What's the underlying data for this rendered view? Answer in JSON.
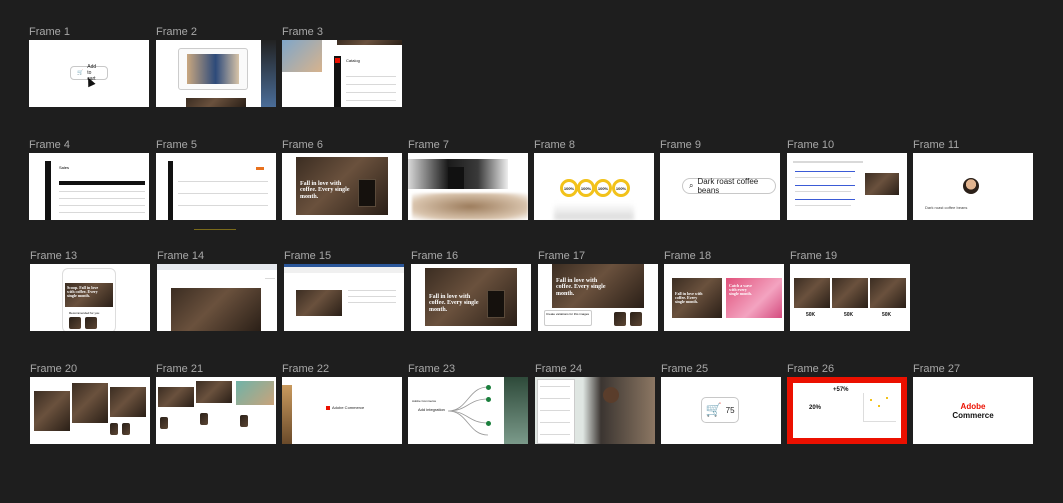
{
  "frames": {
    "f1": {
      "label": "Frame 1",
      "button": "Add to cart"
    },
    "f2": {
      "label": "Frame 2"
    },
    "f3": {
      "label": "Frame 3",
      "heading": "Catalog"
    },
    "f4": {
      "label": "Frame 4",
      "heading": "Sales"
    },
    "f5": {
      "label": "Frame 5"
    },
    "f6": {
      "label": "Frame 6",
      "hero": "Fall in love with coffee. Every single month."
    },
    "f7": {
      "label": "Frame 7"
    },
    "f8": {
      "label": "Frame 8",
      "rings": [
        "100%",
        "100%",
        "100%",
        "100%"
      ]
    },
    "f9": {
      "label": "Frame 9",
      "search": "Dark roast coffee beans"
    },
    "f10": {
      "label": "Frame 10"
    },
    "f11": {
      "label": "Frame 11",
      "chip": "Dark roast coffee beans"
    },
    "f13": {
      "label": "Frame 13",
      "hero": "Scoop. Fall in love with coffee. Every single month.",
      "sub": "Recommended for you"
    },
    "f14": {
      "label": "Frame 14"
    },
    "f15": {
      "label": "Frame 15"
    },
    "f16": {
      "label": "Frame 16",
      "hero": "Fall in love with coffee. Every single month."
    },
    "f17": {
      "label": "Frame 17",
      "hero": "Fall in love with coffee. Every single month.",
      "note": "Create variations for this images"
    },
    "f18": {
      "label": "Frame 18",
      "hero_a": "Fall in love with coffee. Every single month.",
      "hero_b": "Catch a wave with every single month."
    },
    "f19": {
      "label": "Frame 19",
      "stats": [
        "50K",
        "50K",
        "50K"
      ]
    },
    "f20": {
      "label": "Frame 20"
    },
    "f21": {
      "label": "Frame 21"
    },
    "f22": {
      "label": "Frame 22",
      "badge": "Adobe Commerce"
    },
    "f23": {
      "label": "Frame 23",
      "node": "Add integration",
      "title": "Adobe Commerce"
    },
    "f24": {
      "label": "Frame 24"
    },
    "f25": {
      "label": "Frame 25",
      "count": "75"
    },
    "f26": {
      "label": "Frame 26",
      "metric_a": "+57%",
      "metric_b": "20%"
    },
    "f27": {
      "label": "Frame 27",
      "logo_line1": "Adobe",
      "logo_line2": "Commerce"
    }
  },
  "colors": {
    "canvas": "#1e1e1e",
    "label": "#a8a8a8",
    "adobe_red": "#eb1000",
    "ring_yellow": "#f2c21a"
  }
}
